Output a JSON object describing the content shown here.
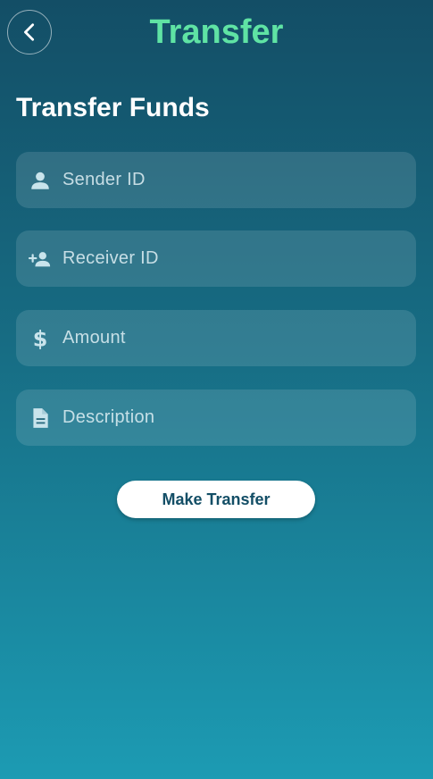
{
  "header": {
    "title": "Transfer",
    "back_icon": "chevron-left-icon",
    "title_color": "#5fe3a4"
  },
  "form": {
    "heading": "Transfer Funds",
    "fields": [
      {
        "icon": "person-icon",
        "placeholder": "Sender ID"
      },
      {
        "icon": "person-add-icon",
        "placeholder": "Receiver ID"
      },
      {
        "icon": "dollar-icon",
        "placeholder": "Amount"
      },
      {
        "icon": "document-icon",
        "placeholder": "Description"
      }
    ],
    "submit_label": "Make Transfer"
  },
  "colors": {
    "gradient_top": "#134e66",
    "gradient_bottom": "#1c9bb3",
    "accent": "#5fe3a4",
    "button_bg": "#ffffff",
    "button_text": "#134e66"
  }
}
